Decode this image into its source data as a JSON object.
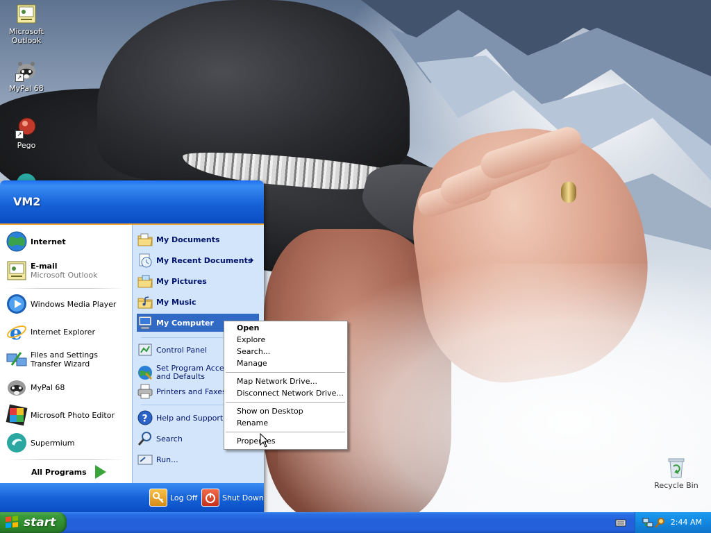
{
  "desktop": {
    "icons": [
      {
        "label": "Microsoft Outlook",
        "icon": "outlook-icon"
      },
      {
        "label": "MyPal 68",
        "icon": "mypal-raccoon-icon"
      },
      {
        "label": "Pego",
        "icon": "pego-icon"
      },
      {
        "label": "Recycle Bin",
        "icon": "recycle-bin-icon"
      }
    ]
  },
  "start_menu": {
    "user": "VM2",
    "pinned": [
      {
        "label": "Internet",
        "icon": "globe-icon"
      },
      {
        "label": "E-mail",
        "sub": "Microsoft Outlook",
        "icon": "outlook-icon"
      }
    ],
    "recent": [
      {
        "label": "Windows Media Player",
        "icon": "media-player-icon"
      },
      {
        "label": "Internet Explorer",
        "icon": "internet-explorer-icon"
      },
      {
        "label": "Files and Settings Transfer Wizard",
        "icon": "transfer-wizard-icon"
      },
      {
        "label": "MyPal 68",
        "icon": "mypal-raccoon-icon"
      },
      {
        "label": "Microsoft Photo Editor",
        "icon": "photo-editor-icon"
      },
      {
        "label": "Supermium",
        "icon": "supermium-icon"
      }
    ],
    "all_programs": "All Programs",
    "places": [
      {
        "label": "My Documents"
      },
      {
        "label": "My Recent Documents"
      },
      {
        "label": "My Pictures"
      },
      {
        "label": "My Music"
      },
      {
        "label": "My Computer"
      }
    ],
    "system": [
      {
        "label": "Control Panel"
      },
      {
        "label": "Set Program Access and Defaults"
      },
      {
        "label": "Printers and Faxes"
      },
      {
        "label": "Help and Support"
      },
      {
        "label": "Search"
      },
      {
        "label": "Run..."
      }
    ],
    "log_off": "Log Off",
    "shut_down": "Shut Down"
  },
  "context_menu": {
    "items": [
      "Open",
      "Explore",
      "Search...",
      "Manage",
      "Map Network Drive...",
      "Disconnect Network Drive...",
      "Show on Desktop",
      "Rename",
      "Properties"
    ]
  },
  "taskbar": {
    "start_label": "start",
    "clock": "2:44 AM"
  },
  "colors": {
    "xp_blue": "#2360da",
    "start_green": "#2e8b2e",
    "highlight": "#316ac5",
    "places_pane": "#d3e5fa"
  }
}
